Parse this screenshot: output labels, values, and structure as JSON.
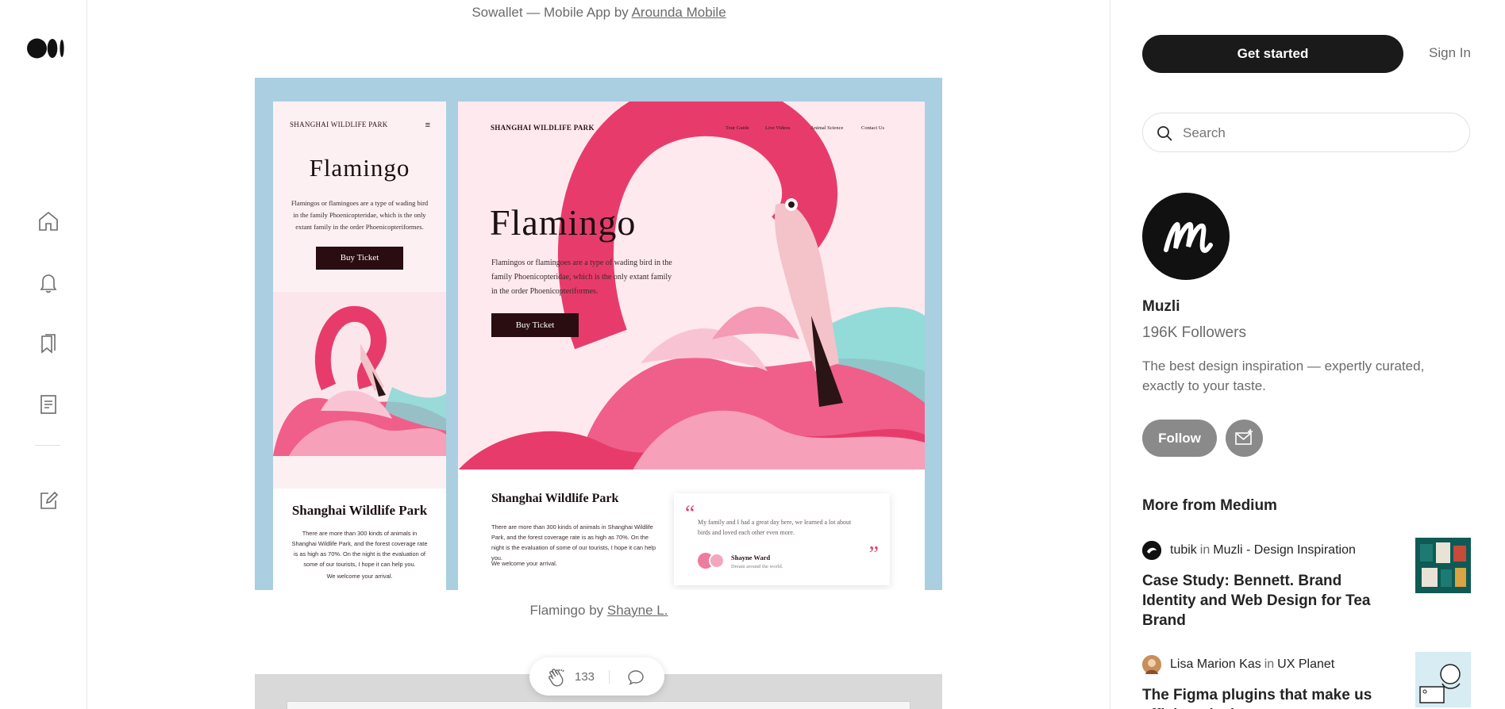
{
  "app": {
    "logo": "medium-logo"
  },
  "nav": {
    "icons": [
      "home-icon",
      "notifications-bell-icon",
      "bookmarks-icon",
      "stories-icon",
      "write-icon"
    ]
  },
  "article": {
    "caption_top_prefix": "Sowallet — Mobile App by ",
    "caption_top_link": "Arounda Mobile",
    "caption_bottom_prefix": "Flamingo by ",
    "caption_bottom_link": "Shayne L.",
    "image": {
      "left": {
        "brand": "SHANGHAI WILDLIFE PARK",
        "title": "Flamingo",
        "body": "Flamingos or flamingoes are a type of wading bird in the family Phoenicopteridae, which is the only extant family in the order Phoenicopteriformes.",
        "button": "Buy Ticket",
        "park_title": "Shanghai Wildlife Park",
        "park_text": "There are more than 300 kinds of animals in Shanghai Wildlife Park, and the forest coverage rate is as high as 70%. On the night is the evaluation of some of our tourists, I hope it can help you.",
        "welcome": "We welcome your arrival."
      },
      "right": {
        "brand": "SHANGHAI WILDLIFE PARK",
        "menu": [
          "Tour Guide",
          "Live Videos",
          "Animal Science",
          "Contact Us"
        ],
        "title": "Flamingo",
        "body": "Flamingos or flamingoes are a type of wading bird in the family Phoenicopteridae, which is the only extant family in the order Phoenicopteriformes.",
        "button": "Buy Ticket",
        "park_title": "Shanghai Wildlife Park",
        "park_text": "There are more than 300 kinds of animals in Shanghai Wildlife Park, and the forest coverage rate is as high as 70%. On the night is the evaluation of some of our tourists, I hope it can help you.",
        "welcome": "We welcome your arrival.",
        "quote": "My family and I had a great day here, we learned a lot about birds and loved each other even more.",
        "quote_author": "Shayne Ward",
        "quote_role": "Dream around the world."
      }
    },
    "claps": "133"
  },
  "sidebar": {
    "get_started": "Get started",
    "sign_in": "Sign In",
    "search_placeholder": "Search",
    "publication": {
      "name": "Muzli",
      "followers": "196K Followers",
      "description": "The best design inspiration — expertly curated, exactly to your taste.",
      "follow": "Follow"
    },
    "more_heading": "More from Medium",
    "recommendations": [
      {
        "author": "tubik",
        "in": "in",
        "publication": "Muzli - Design Inspiration",
        "title": "Case Study: Bennett. Brand Identity and Web Design for Tea Brand"
      },
      {
        "author": "Lisa Marion Kas",
        "in": "in",
        "publication": "UX Planet",
        "title": "The Figma plugins that make us efficient designers"
      }
    ]
  }
}
